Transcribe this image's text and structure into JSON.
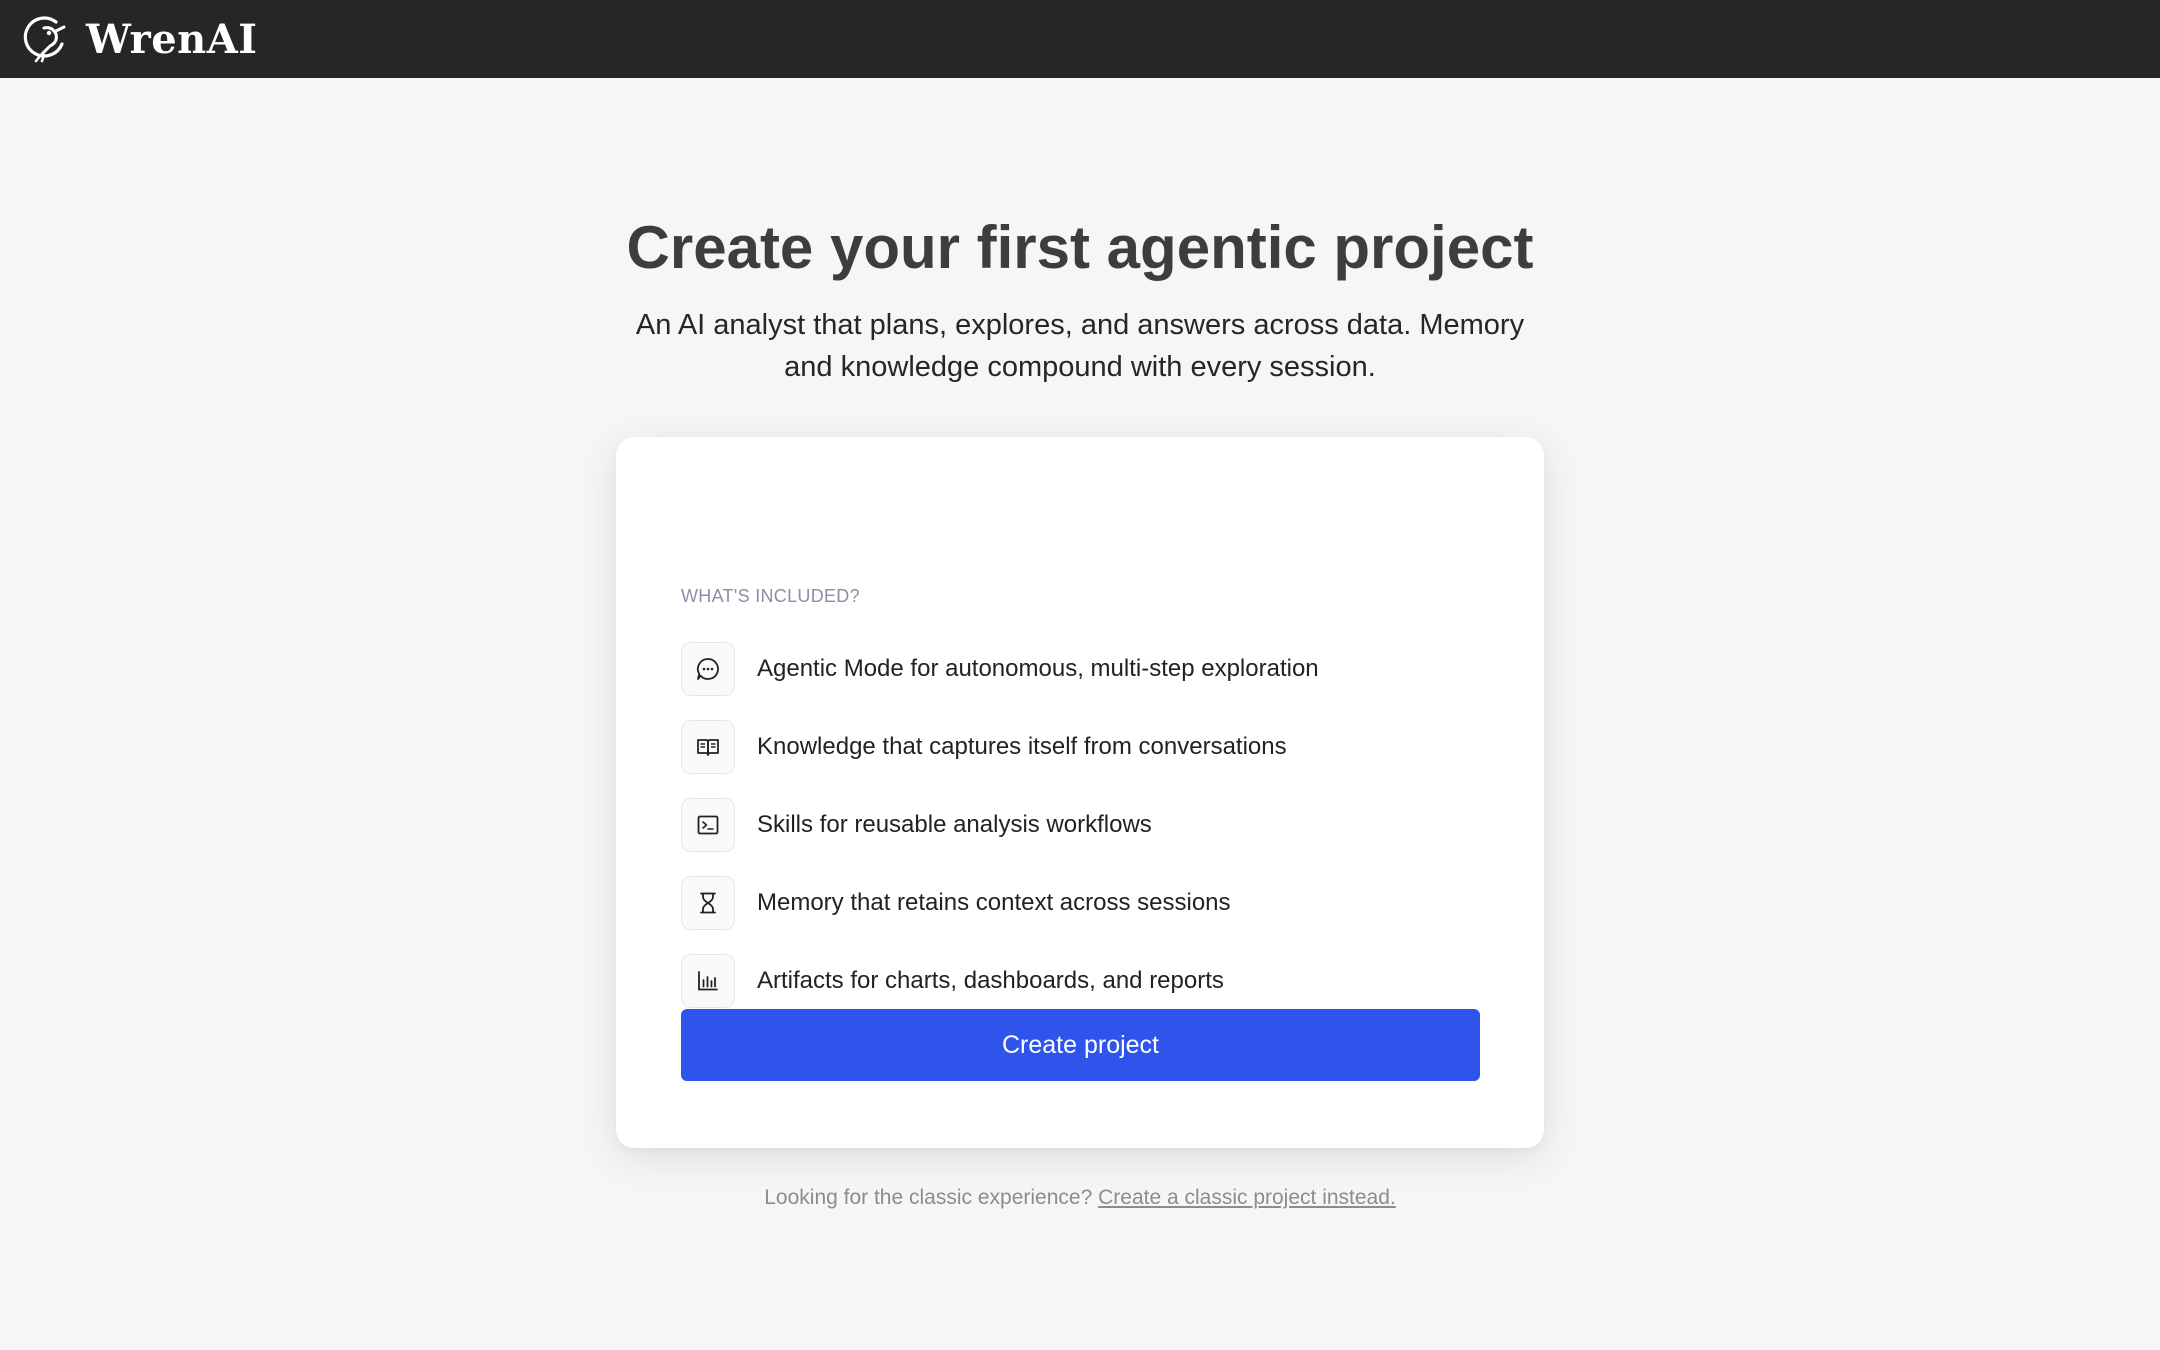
{
  "app": {
    "name": "WrenAI"
  },
  "hero": {
    "title": "Create your first agentic project",
    "subtitle": "An AI analyst that plans, explores, and answers across data. Memory and knowledge compound with every session."
  },
  "card": {
    "heading": "WHAT'S INCLUDED?",
    "features": [
      {
        "icon": "chat-bubble-icon",
        "label": "Agentic Mode for autonomous, multi-step exploration"
      },
      {
        "icon": "book-open-icon",
        "label": "Knowledge that captures itself from conversations"
      },
      {
        "icon": "terminal-icon",
        "label": "Skills for reusable analysis workflows"
      },
      {
        "icon": "hourglass-icon",
        "label": "Memory that retains context across sessions"
      },
      {
        "icon": "bar-chart-icon",
        "label": "Artifacts for charts, dashboards, and reports"
      }
    ],
    "button_label": "Create project"
  },
  "footer": {
    "prompt": "Looking for the classic experience?",
    "link_label": "Create a classic project instead."
  },
  "colors": {
    "topbar": "#262626",
    "primary": "#2f54eb",
    "background": "#f6f6f6"
  }
}
